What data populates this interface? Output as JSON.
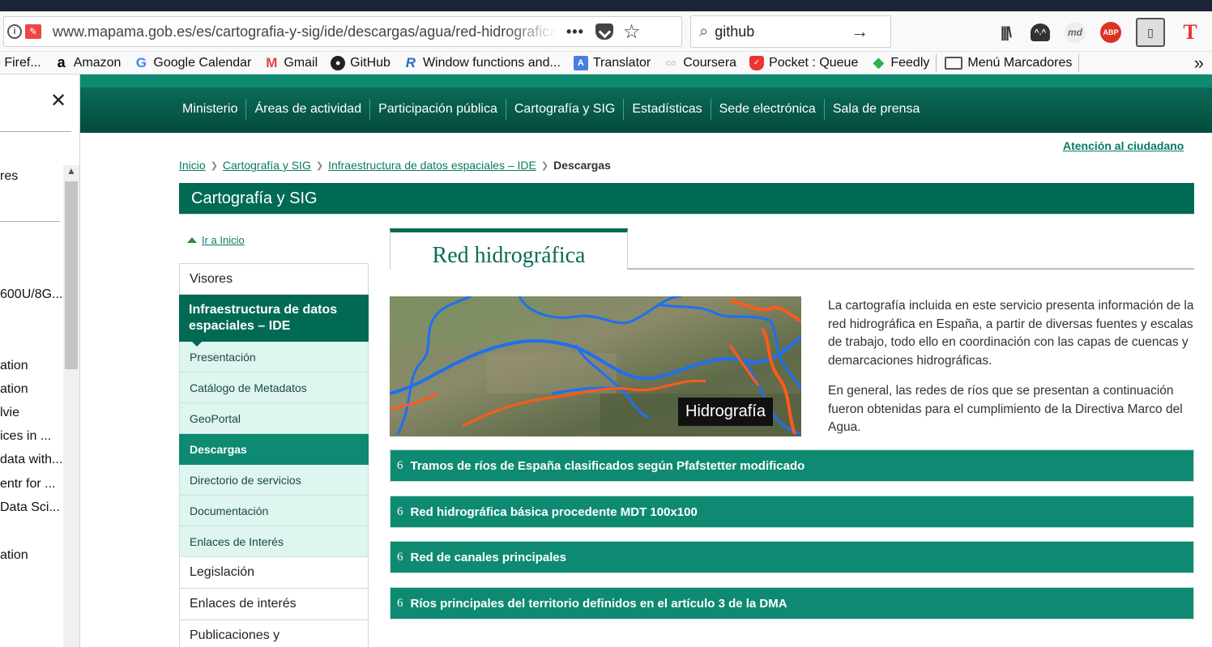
{
  "browser": {
    "url": "www.mapama.gob.es/es/cartografia-y-sig/ide/descargas/agua/red-hidrografica",
    "page_actions": "•••",
    "search_value": "github",
    "bookmarks": [
      {
        "label": "e Firef...",
        "icon": "firefox-icon"
      },
      {
        "label": "Amazon",
        "icon": "amazon-icon"
      },
      {
        "label": "Google Calendar",
        "icon": "google-icon"
      },
      {
        "label": "Gmail",
        "icon": "gmail-icon"
      },
      {
        "label": "GitHub",
        "icon": "github-icon"
      },
      {
        "label": "Window functions and...",
        "icon": "r-icon"
      },
      {
        "label": "Translator",
        "icon": "translator-icon"
      },
      {
        "label": "Coursera",
        "icon": "coursera-icon"
      },
      {
        "label": "Pocket : Queue",
        "icon": "pocket-icon"
      },
      {
        "label": "Feedly",
        "icon": "feedly-icon"
      },
      {
        "label": "Menú Marcadores",
        "icon": "folder-icon"
      }
    ],
    "toolbar_icons": {
      "abp": "ABP",
      "md": "md",
      "t": "T"
    }
  },
  "sidebar": {
    "items": [
      {
        "label": "res",
        "top": 0
      },
      {
        "label": "600U/8G...",
        "top": 0
      },
      {
        "label": "ation",
        "top": 0
      },
      {
        "label": "ation",
        "top": 0
      },
      {
        "label": "lvie",
        "top": 0
      },
      {
        "label": "ices in ...",
        "top": 0
      },
      {
        "label": "data with...",
        "top": 0
      },
      {
        "label": "entr for ...",
        "top": 0
      },
      {
        "label": " Data Sci...",
        "top": 0
      },
      {
        "label": "ation",
        "top": 0
      }
    ]
  },
  "site": {
    "nav": [
      "Ministerio",
      "Áreas de actividad",
      "Participación pública",
      "Cartografía y SIG",
      "Estadísticas",
      "Sede electrónica",
      "Sala de prensa"
    ],
    "atencion": "Atención al ciudadano",
    "breadcrumb": [
      "Inicio",
      "Cartografía y SIG",
      "Infraestructura de datos espaciales – IDE",
      "Descargas"
    ],
    "section_title": "Cartografía y SIG",
    "ir_inicio": "Ir a Inicio"
  },
  "menu": {
    "visores": "Visores",
    "ide": "Infraestructura de datos espaciales – IDE",
    "sub": [
      "Presentación",
      "Catálogo de Metadatos",
      "GeoPortal",
      "Descargas",
      "Directorio de servicios",
      "Documentación",
      "Enlaces de Interés"
    ],
    "legislacion": "Legislación",
    "enlaces": "Enlaces de interés",
    "publicaciones": "Publicaciones y"
  },
  "main": {
    "title": "Red hidrográfica",
    "map_label": "Hidrografía",
    "paragraphs": [
      "La cartografía incluida en este servicio presenta información de la red hidrográfica en España, a partir de diversas fuentes y escalas de trabajo, todo ello en coordinación con las capas de cuencas y demarcaciones hidrográficas.",
      "En general, las redes de ríos que se presentan a continuación fueron obtenidas para el cumplimiento de la Directiva Marco del Agua."
    ],
    "accordions": [
      {
        "num": "6",
        "label": "Tramos de ríos de España clasificados según Pfafstetter modificado"
      },
      {
        "num": "6",
        "label": "Red hidrográfica básica procedente MDT 100x100"
      },
      {
        "num": "6",
        "label": "Red de canales principales"
      },
      {
        "num": "6",
        "label": "Ríos principales del territorio definidos en el artículo 3 de la DMA"
      }
    ]
  }
}
